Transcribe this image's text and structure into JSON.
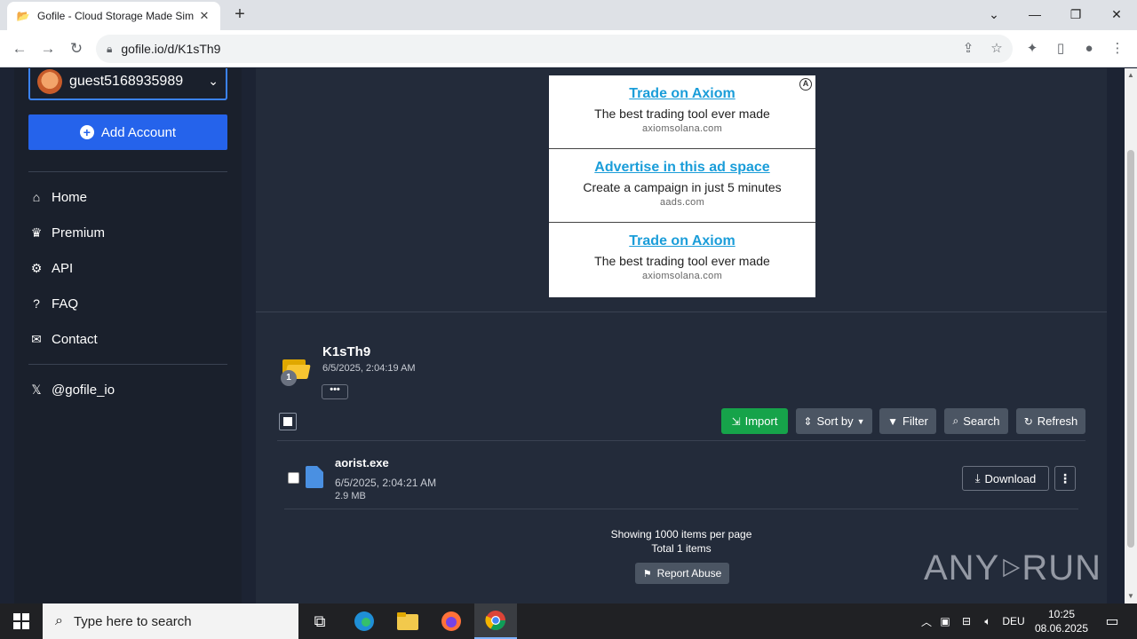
{
  "browser": {
    "tab_title": "Gofile - Cloud Storage Made Sim",
    "tab_favicon": "📂",
    "tab_close": "✕",
    "new_tab": "+",
    "url": "gofile.io/d/K1sTh9"
  },
  "sidebar": {
    "account_name": "guest5168935989",
    "add_account_label": "Add Account",
    "nav": [
      {
        "label": "Home",
        "icon": "home-icon"
      },
      {
        "label": "Premium",
        "icon": "crown-icon"
      },
      {
        "label": "API",
        "icon": "cogs-icon"
      },
      {
        "label": "FAQ",
        "icon": "question-icon"
      },
      {
        "label": "Contact",
        "icon": "envelope-icon"
      }
    ],
    "social": "@gofile_io"
  },
  "ads": [
    {
      "title": "Trade on Axiom",
      "desc": "The best trading tool ever made",
      "domain": "axiomsolana.com"
    },
    {
      "title": "Advertise in this ad space",
      "desc": "Create a campaign in just 5 minutes",
      "domain": "aads.com"
    },
    {
      "title": "Trade on Axiom",
      "desc": "The best trading tool ever made",
      "domain": "axiomsolana.com"
    }
  ],
  "ad_badge": "A",
  "folder": {
    "name": "K1sTh9",
    "date": "6/5/2025, 2:04:19 AM",
    "count": "1",
    "options_label": "•••"
  },
  "actions": {
    "import": "Import",
    "sort": "Sort by",
    "filter": "Filter",
    "search": "Search",
    "refresh": "Refresh"
  },
  "files": [
    {
      "name": "aorist.exe",
      "date": "6/5/2025, 2:04:21 AM",
      "size": "2.9 MB",
      "download_label": "Download"
    }
  ],
  "footer": {
    "showing": "Showing 1000 items per page",
    "total": "Total 1 items",
    "report": "Report Abuse"
  },
  "watermark": {
    "left": "ANY",
    "right": "RUN"
  },
  "taskbar": {
    "search_placeholder": "Type here to search",
    "language": "DEU",
    "time": "10:25",
    "date": "08.06.2025"
  },
  "colors": {
    "accent": "#2563eb",
    "import_green": "#16a34a",
    "ad_link": "#1a9dd9",
    "page_bg": "#1c2333"
  }
}
